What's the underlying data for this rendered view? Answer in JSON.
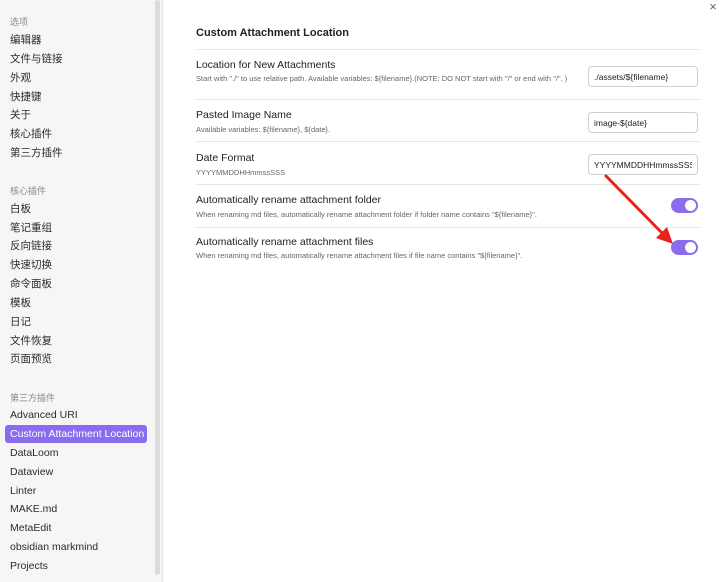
{
  "sidebar": {
    "sections": [
      {
        "heading": "选项",
        "items": [
          "编辑器",
          "文件与链接",
          "外观",
          "快捷键",
          "关于",
          "核心插件",
          "第三方插件"
        ]
      },
      {
        "heading": "核心插件",
        "items": [
          "白板",
          "笔记重组",
          "反向链接",
          "快速切换",
          "命令面板",
          "模板",
          "日记",
          "文件恢复",
          "页面预览"
        ]
      },
      {
        "heading": "第三方插件",
        "items": [
          "Advanced URI",
          "Custom Attachment Location",
          "DataLoom",
          "Dataview",
          "Linter",
          "MAKE.md",
          "MetaEdit",
          "obsidian markmind",
          "Projects"
        ]
      }
    ],
    "active_item": "Custom Attachment Location"
  },
  "close_icon": "×",
  "settings": {
    "title": "Custom Attachment Location",
    "rows": [
      {
        "name": "Location for New Attachments",
        "desc": "Start with \"./\" to use relative path. Available variables: ${filename}.(NOTE: DO NOT start with \"/\" or end with \"/\". )",
        "control": "text",
        "value": "./assets/${filename}"
      },
      {
        "name": "Pasted Image Name",
        "desc": "Available variables: ${filename}, ${date}.",
        "control": "text",
        "value": "image-${date}"
      },
      {
        "name": "Date Format",
        "desc": "YYYYMMDDHHmmssSSS",
        "control": "text",
        "value": "YYYYMMDDHHmmssSSS"
      },
      {
        "name": "Automatically rename attachment folder",
        "desc": "When renaming md files, automatically rename attachment folder if folder name contains \"${filename}\".",
        "control": "toggle",
        "enabled": true
      },
      {
        "name": "Automatically rename attachment files",
        "desc": "When renaming md files, automatically rename attachment files if file name contains \"${filename}\".",
        "control": "toggle",
        "enabled": true
      }
    ]
  },
  "colors": {
    "accent": "#8b6cef",
    "annotation_arrow": "#e8231c"
  }
}
